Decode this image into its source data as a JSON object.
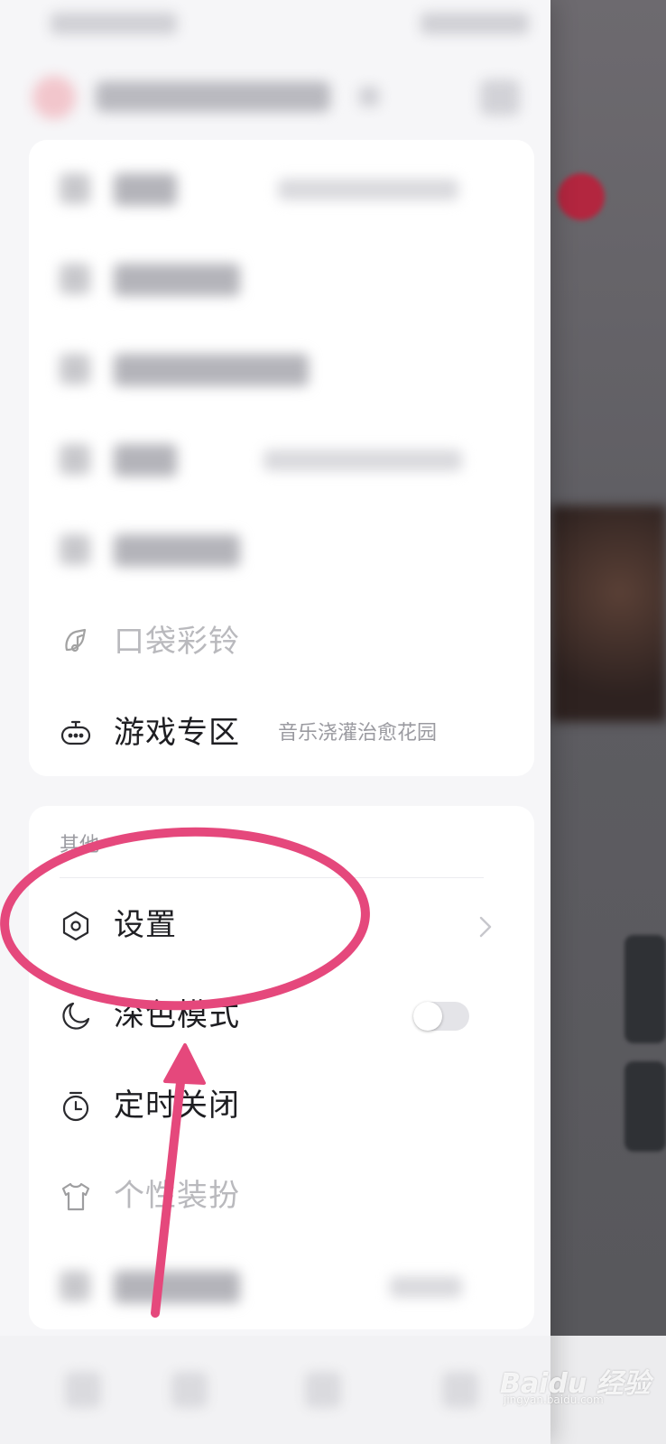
{
  "menu": {
    "blurred_rows_card1": 5,
    "items": [
      {
        "label": "口袋彩铃",
        "icon": "music-bell-icon"
      },
      {
        "label": "游戏专区",
        "sub": "音乐浇灌治愈花园",
        "icon": "gamepad-icon"
      }
    ]
  },
  "other_section": {
    "title": "其他",
    "items": [
      {
        "label": "设置",
        "icon": "settings-hexagon-icon"
      },
      {
        "label": "深色模式",
        "icon": "moon-icon",
        "toggle_on": false
      },
      {
        "label": "定时关闭",
        "icon": "timer-icon"
      },
      {
        "label": "个性装扮",
        "icon": "tshirt-icon"
      }
    ]
  },
  "annotation": {
    "color": "#e5487c",
    "type": "ellipse-and-arrow",
    "target": "设置"
  },
  "watermark": {
    "main": "Baidu 经验",
    "url": "jingyan.baidu.com"
  }
}
